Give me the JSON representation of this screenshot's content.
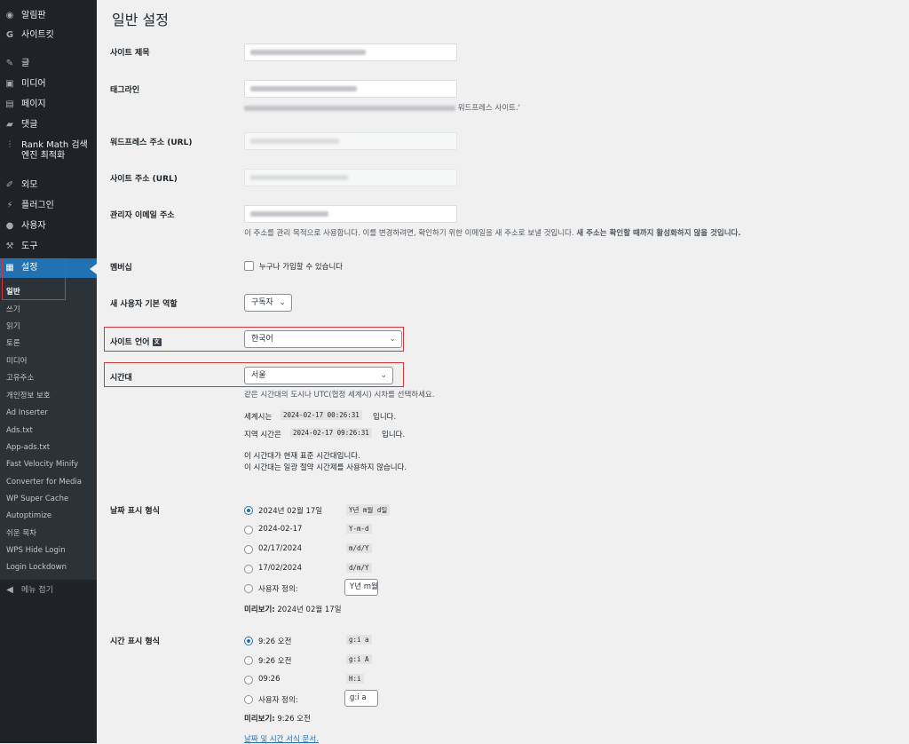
{
  "sidebar": {
    "top_items": [
      {
        "label": "알림판",
        "icon": "dashboard-icon"
      },
      {
        "label": "사이트킷",
        "icon": "sitekit-icon"
      }
    ],
    "items": [
      {
        "label": "글",
        "icon": "pin-icon"
      },
      {
        "label": "미디어",
        "icon": "media-icon"
      },
      {
        "label": "페이지",
        "icon": "page-icon"
      },
      {
        "label": "댓글",
        "icon": "comment-icon"
      },
      {
        "label": "Rank Math 검색엔진 최적화",
        "icon": "rankmath-icon"
      },
      {
        "label": "외모",
        "icon": "brush-icon"
      },
      {
        "label": "플러그인",
        "icon": "plugin-icon"
      },
      {
        "label": "사용자",
        "icon": "user-icon"
      },
      {
        "label": "도구",
        "icon": "wrench-icon"
      },
      {
        "label": "설정",
        "icon": "settings-icon"
      }
    ],
    "submenu": [
      "일반",
      "쓰기",
      "읽기",
      "토론",
      "미디어",
      "고유주소",
      "개인정보 보호",
      "Ad Inserter",
      "Ads.txt",
      "App-ads.txt",
      "Fast Velocity Minify",
      "Converter for Media",
      "WP Super Cache",
      "Autoptimize",
      "쉬운 목차",
      "WPS Hide Login",
      "Login Lockdown"
    ],
    "collapse_label": "메뉴 접기"
  },
  "page": {
    "title": "일반 설정",
    "site_title_label": "사이트 제목",
    "tagline_label": "태그라인",
    "tagline_desc_suffix": "워드프레스 사이트.'",
    "wp_url_label": "워드프레스 주소 (URL)",
    "site_url_label": "사이트 주소 (URL)",
    "admin_email_label": "관리자 이메일 주소",
    "admin_email_desc_plain": "이 주소를 관리 목적으로 사용합니다. 이를 변경하려면, 확인하기 위한 이메일을 새 주소로 보낼 것입니다. ",
    "admin_email_desc_bold": "새 주소는 확인할 때까지 활성화하지 않을 것입니다.",
    "membership_label": "멤버십",
    "membership_checkbox": "누구나 가입할 수 있습니다",
    "default_role_label": "새 사용자 기본 역할",
    "default_role_value": "구독자",
    "site_language_label": "사이트 언어",
    "site_language_value": "한국어",
    "timezone_label": "시간대",
    "timezone_value": "서울",
    "timezone_desc": "같은 시간대의 도시나 UTC(협정 세계시) 시차를 선택하세요.",
    "utc_prefix": "세계시는",
    "utc_time": "2024-02-17 00:26:31",
    "utc_suffix": "입니다.",
    "local_prefix": "지역 시간은",
    "local_time": "2024-02-17 09:26:31",
    "local_suffix": "입니다.",
    "std_note_1": "이 시간대가 현재 표준 시간대입니다.",
    "std_note_2": "이 시간대는 일광 절약 시간제를 사용하지 않습니다.",
    "date_format_label": "날짜 표시 형식",
    "date_options": [
      {
        "label": "2024년 02월 17일",
        "code": "Y년 m월 d일",
        "checked": true
      },
      {
        "label": "2024-02-17",
        "code": "Y-m-d",
        "checked": false
      },
      {
        "label": "02/17/2024",
        "code": "m/d/Y",
        "checked": false
      },
      {
        "label": "17/02/2024",
        "code": "d/m/Y",
        "checked": false
      }
    ],
    "custom_label": "사용자 정의:",
    "date_custom_value": "Y년 m월 d일",
    "preview_label": "미리보기:",
    "date_preview": "2024년 02월 17일",
    "time_format_label": "시간 표시 형식",
    "time_options": [
      {
        "label": "9:26 오전",
        "code": "g:i a",
        "checked": true
      },
      {
        "label": "9:26 오전",
        "code": "g:i A",
        "checked": false
      },
      {
        "label": "09:26",
        "code": "H:i",
        "checked": false
      }
    ],
    "time_custom_value": "g:i a",
    "time_preview": "9:26 오전",
    "doc_link": "날짜 및 시간 서식 문서."
  }
}
